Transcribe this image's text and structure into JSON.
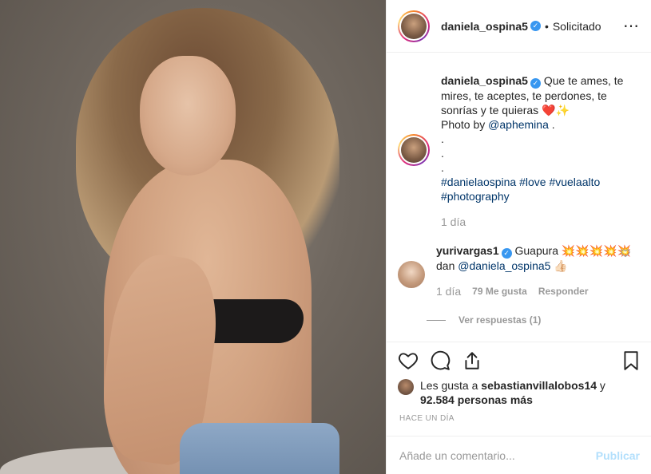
{
  "header": {
    "username": "daniela_ospina5",
    "separator": "•",
    "follow_status": "Solicitado",
    "more_icon": "⋯"
  },
  "caption": {
    "username": "daniela_ospina5",
    "text": "Que te ames, te mires, te aceptes, te perdones, te sonrías y te quieras ❤️✨",
    "photo_by": "Photo by",
    "photo_handle": "@aphemina",
    "photo_end": " .",
    "dots": [
      ".",
      ".",
      "."
    ],
    "hashtags": [
      "#danielaospina",
      "#love",
      "#vuelaalto",
      "#photography"
    ],
    "time": "1 día"
  },
  "comment": {
    "username": "yurivargas1",
    "text_before": "Guapura 💥💥💥💥💥 dan",
    "mention": "@daniela_ospina5",
    "text_after": " 👍🏻",
    "time": "1 día",
    "likes": "79 Me gusta",
    "reply": "Responder",
    "view_replies": "Ver respuestas (1)"
  },
  "likes": {
    "prefix": "Les gusta a",
    "user": "sebastianvillalobos14",
    "connector": "y",
    "others": "92.584 personas más"
  },
  "timestamp": "HACE UN DÍA",
  "add_comment": {
    "placeholder": "Añade un comentario...",
    "publish": "Publicar"
  },
  "colors": {
    "verified": "#3897f0",
    "link": "#003569",
    "muted": "#999999",
    "publish_disabled": "#b2dffc"
  }
}
